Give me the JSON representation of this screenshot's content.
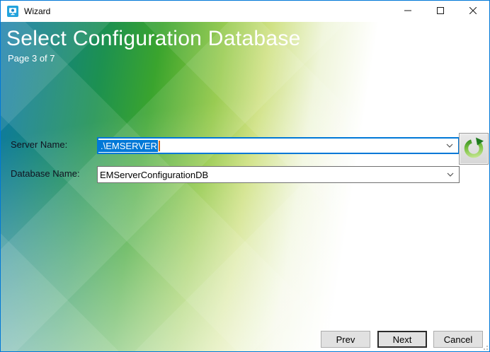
{
  "window": {
    "title": "Wizard",
    "icons": {
      "app_icon": "wizard-monitor-icon",
      "minimize": "minimize-dash",
      "maximize": "maximize-square",
      "close": "close-x"
    }
  },
  "header": {
    "title": "Select Configuration Database",
    "page_indicator": "Page 3 of 7"
  },
  "form": {
    "server_name": {
      "label": "Server Name:",
      "value": ".\\EMSERVER",
      "selected": true
    },
    "database_name": {
      "label": "Database Name:",
      "value": "EMServerConfigurationDB"
    },
    "refresh_icon": "refresh-circular-arrow"
  },
  "footer": {
    "prev_label": "Prev",
    "next_label": "Next",
    "cancel_label": "Cancel"
  },
  "colors": {
    "accent": "#0078d7",
    "selection_highlight": "#0078d7",
    "caret": "#d4681e",
    "gradient_blue": "#0d78a9",
    "gradient_green": "#3aa42e",
    "gradient_yellow_green": "#cade76",
    "header_text": "#ffffff"
  }
}
